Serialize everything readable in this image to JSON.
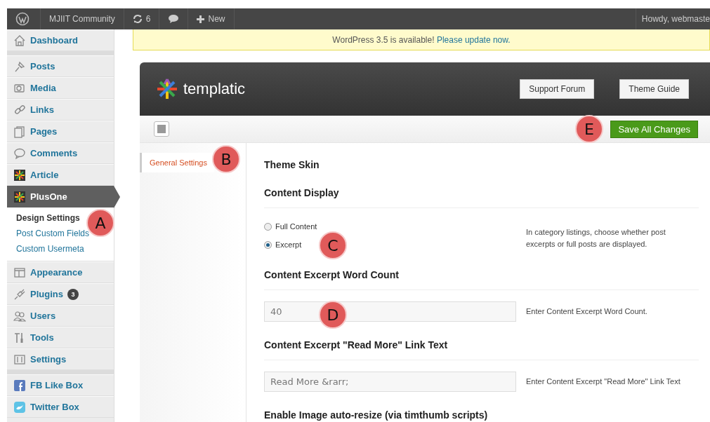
{
  "admin_bar": {
    "site": "MJIIT Community",
    "updates": "6",
    "new": "New",
    "account": "Howdy, webmaste"
  },
  "sidebar": {
    "groups": [
      [
        {
          "label": "Dashboard",
          "selected": false
        }
      ],
      [
        {
          "label": "Posts",
          "selected": false
        },
        {
          "label": "Media",
          "selected": false
        },
        {
          "label": "Links",
          "selected": false
        },
        {
          "label": "Pages",
          "selected": false
        },
        {
          "label": "Comments",
          "selected": false
        },
        {
          "label": "Article",
          "selected": false
        },
        {
          "label": "PlusOne",
          "selected": true,
          "children": [
            {
              "label": "Design Settings",
              "selected": true
            },
            {
              "label": "Post Custom Fields",
              "selected": false
            },
            {
              "label": "Custom Usermeta",
              "selected": false
            }
          ]
        },
        {
          "label": "Appearance",
          "selected": false
        },
        {
          "label": "Plugins",
          "selected": false,
          "badge": "3"
        },
        {
          "label": "Users",
          "selected": false
        },
        {
          "label": "Tools",
          "selected": false
        },
        {
          "label": "Settings",
          "selected": false
        }
      ],
      [
        {
          "label": "FB Like Box",
          "selected": false
        },
        {
          "label": "Twitter Box",
          "selected": false
        }
      ]
    ]
  },
  "notice": {
    "text": "WordPress 3.5 is available!",
    "link": "Please update now."
  },
  "panel": {
    "logo": "templatic",
    "buttons": [
      "Support Forum",
      "Theme Guide"
    ],
    "save": "Save All Changes",
    "nav": [
      {
        "label": "General Settings",
        "selected": true
      }
    ],
    "sections": [
      {
        "kind": "heading",
        "text": "Theme Skin",
        "divider": false
      },
      {
        "kind": "heading",
        "text": "Content Display",
        "divider": true
      },
      {
        "kind": "radios",
        "options": [
          {
            "label": "Full Content",
            "selected": false
          },
          {
            "label": "Excerpt",
            "selected": true
          }
        ],
        "help": "In category listings, choose whether post excerpts or full posts are displayed."
      },
      {
        "kind": "heading",
        "text": "Content Excerpt Word Count",
        "divider": true
      },
      {
        "kind": "input",
        "value": "40",
        "help": "Enter Content Excerpt Word Count."
      },
      {
        "kind": "heading",
        "text": "Content Excerpt \"Read More\" Link Text",
        "divider": true
      },
      {
        "kind": "input",
        "value": "Read More &rarr;",
        "help": "Enter Content Excerpt \"Read More\" Link Text"
      },
      {
        "kind": "heading",
        "text": "Enable Image auto-resize (via timthumb scripts)",
        "divider": false
      }
    ]
  },
  "annotations": [
    {
      "label": "A"
    },
    {
      "label": "B"
    },
    {
      "label": "C"
    },
    {
      "label": "D"
    },
    {
      "label": "E"
    }
  ]
}
